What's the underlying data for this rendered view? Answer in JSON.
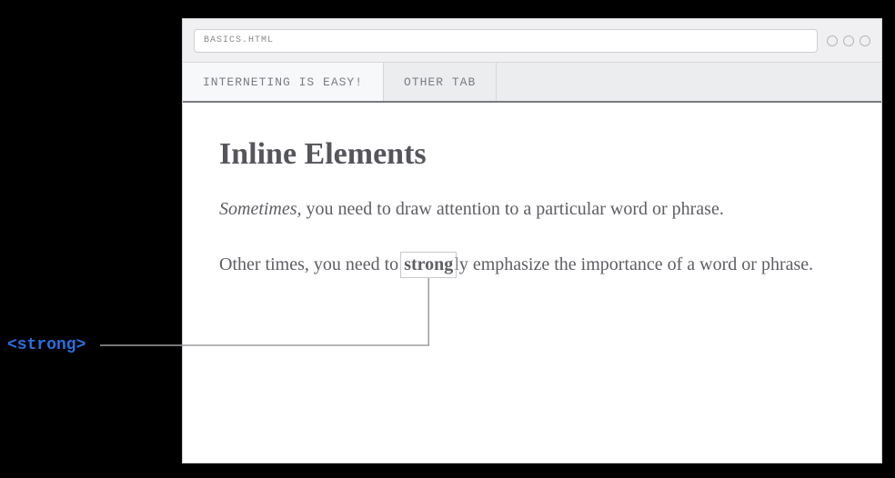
{
  "address_bar": {
    "url": "BASICS.HTML"
  },
  "tabs": [
    {
      "label": "INTERNETING IS EASY!",
      "active": true
    },
    {
      "label": "OTHER TAB",
      "active": false
    }
  ],
  "page": {
    "heading": "Inline Elements",
    "p1_em": "Sometimes,",
    "p1_rest": " you need to draw attention to a particular word or phrase.",
    "p2_before": "Other times, you need to ",
    "p2_strong": "strong",
    "p2_after": "ly emphasize the importance of a word or phrase."
  },
  "annotation": {
    "label": "<strong>"
  }
}
